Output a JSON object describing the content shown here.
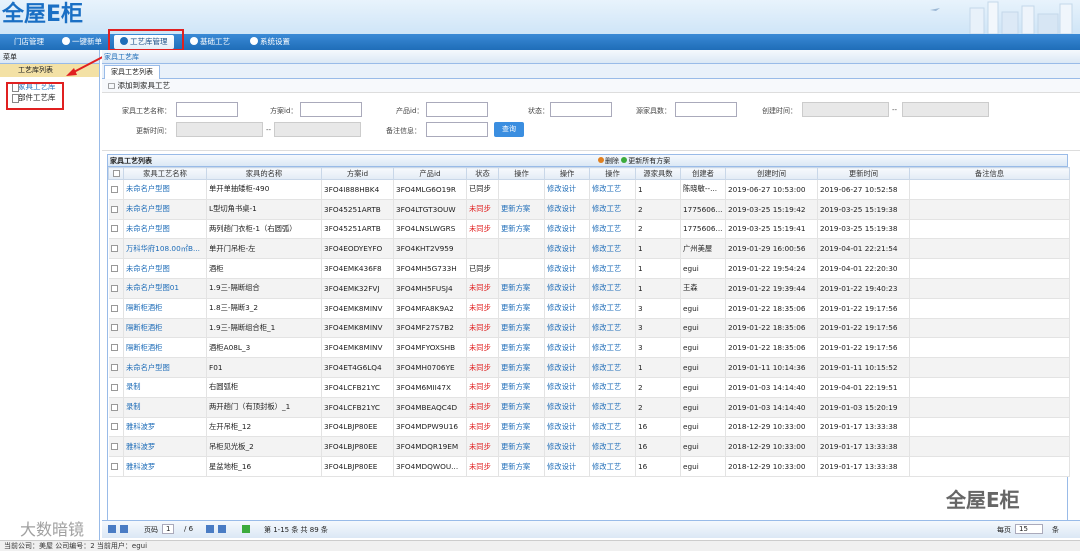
{
  "app": {
    "logo": "全屋E柜"
  },
  "nav": {
    "items": [
      {
        "label": "门店管理"
      },
      {
        "label": "一键新单"
      },
      {
        "label": "工艺库管理"
      },
      {
        "label": "基础工艺"
      },
      {
        "label": "系统设置"
      }
    ]
  },
  "sidebar": {
    "header": "菜单",
    "title": "工艺库列表",
    "items": [
      {
        "label": "家具工艺库"
      },
      {
        "label": "部件工艺库"
      }
    ]
  },
  "main": {
    "breadcrumb": "家具工艺库",
    "tab": "家具工艺列表",
    "add_label": "添加到家具工艺",
    "filters": {
      "craft_name": "家具工艺名称：",
      "square_id": "方案id：",
      "product_id": "产品id：",
      "state": "状态：",
      "source_count": "源家具数：",
      "create_time": "创建时间：",
      "update_time": "更新时间：",
      "remark": "备注信息：",
      "range_sep": "--",
      "query": "查询"
    },
    "grid": {
      "title": "家具工艺列表",
      "delete_label": "删除",
      "update_all_label": "更新所有方案",
      "columns": [
        "家具工艺名称",
        "家具的名称",
        "方案id",
        "产品id",
        "状态",
        "操作",
        "操作",
        "操作",
        "源家具数",
        "创建者",
        "创建时间",
        "更新时间",
        "备注信息"
      ],
      "rows": [
        [
          "未命名户型图",
          "单开单抽矮柜-490",
          "3FO4I888HBK4",
          "3FO4MLG6O19R",
          "已同步",
          "",
          "修改设计",
          "修改工艺",
          "1",
          "陈晓敏--...",
          "2019-06-27 10:53:00",
          "2019-06-27 10:52:58",
          ""
        ],
        [
          "未命名户型图",
          "L型切角书桌-1",
          "3FO45251ARTB",
          "3FO4LTGT3OUW",
          "未同步",
          "更新方案",
          "修改设计",
          "修改工艺",
          "2",
          "1775606...",
          "2019-03-25 15:19:42",
          "2019-03-25 15:19:38",
          ""
        ],
        [
          "未命名户型图",
          "两列趟门衣柜-1（右圆弧）",
          "3FO45251ARTB",
          "3FO4LNSLWGRS",
          "未同步",
          "更新方案",
          "修改设计",
          "修改工艺",
          "2",
          "1775606...",
          "2019-03-25 15:19:41",
          "2019-03-25 15:19:38",
          ""
        ],
        [
          "万科华府108.00㎡B...",
          "单开门吊柜-左",
          "3FO4EODYEYFO",
          "3FO4KHT2V959",
          "",
          "",
          "修改设计",
          "修改工艺",
          "1",
          "广州美屋",
          "2019-01-29 16:00:56",
          "2019-04-01 22:21:54",
          ""
        ],
        [
          "未命名户型图",
          "酒柜",
          "3FO4EMK436F8",
          "3FO4MH5G733H",
          "已同步",
          "",
          "修改设计",
          "修改工艺",
          "1",
          "egui",
          "2019-01-22 19:54:24",
          "2019-04-01 22:20:30",
          ""
        ],
        [
          "未命名户型图01",
          "1.9三-隔断组合",
          "3FO4EMK32FVJ",
          "3FO4MH5FUSJ4",
          "未同步",
          "更新方案",
          "修改设计",
          "修改工艺",
          "1",
          "王森",
          "2019-01-22 19:39:44",
          "2019-01-22 19:40:23",
          ""
        ],
        [
          "隔断柜酒柜",
          "1.8三-隔断3_2",
          "3FO4EMK8MINV",
          "3FO4MFA8K9A2",
          "未同步",
          "更新方案",
          "修改设计",
          "修改工艺",
          "3",
          "egui",
          "2019-01-22 18:35:06",
          "2019-01-22 19:17:56",
          ""
        ],
        [
          "隔断柜酒柜",
          "1.9三-隔断组合柜_1",
          "3FO4EMK8MINV",
          "3FO4MF27S7B2",
          "未同步",
          "更新方案",
          "修改设计",
          "修改工艺",
          "3",
          "egui",
          "2019-01-22 18:35:06",
          "2019-01-22 19:17:56",
          ""
        ],
        [
          "隔断柜酒柜",
          "酒柜A08L_3",
          "3FO4EMK8MINV",
          "3FO4MFYOXSHB",
          "未同步",
          "更新方案",
          "修改设计",
          "修改工艺",
          "3",
          "egui",
          "2019-01-22 18:35:06",
          "2019-01-22 19:17:56",
          ""
        ],
        [
          "未命名户型图",
          "F01",
          "3FO4ET4G6LQ4",
          "3FO4MH0706YE",
          "未同步",
          "更新方案",
          "修改设计",
          "修改工艺",
          "1",
          "egui",
          "2019-01-11 10:14:36",
          "2019-01-11 10:15:52",
          ""
        ],
        [
          "录制",
          "右圆弧柜",
          "3FO4LCFB21YC",
          "3FO4M6MII47X",
          "未同步",
          "更新方案",
          "修改设计",
          "修改工艺",
          "2",
          "egui",
          "2019-01-03 14:14:40",
          "2019-04-01 22:19:51",
          ""
        ],
        [
          "录制",
          "两开趟门（有顶封板）_1",
          "3FO4LCFB21YC",
          "3FO4MBEAQC4D",
          "未同步",
          "更新方案",
          "修改设计",
          "修改工艺",
          "2",
          "egui",
          "2019-01-03 14:14:40",
          "2019-01-03 15:20:19",
          ""
        ],
        [
          "雅科波罗",
          "左开吊柜_12",
          "3FO4LBJP80EE",
          "3FO4MDPW9U16",
          "未同步",
          "更新方案",
          "修改设计",
          "修改工艺",
          "16",
          "egui",
          "2018-12-29 10:33:00",
          "2019-01-17 13:33:38",
          ""
        ],
        [
          "雅科波罗",
          "吊柜见光板_2",
          "3FO4LBJP80EE",
          "3FO4MDQR19EM",
          "未同步",
          "更新方案",
          "修改设计",
          "修改工艺",
          "16",
          "egui",
          "2018-12-29 10:33:00",
          "2019-01-17 13:33:38",
          ""
        ],
        [
          "雅科波罗",
          "星盆地柜_16",
          "3FO4LBJP80EE",
          "3FO4MDQWOU...",
          "未同步",
          "更新方案",
          "修改设计",
          "修改工艺",
          "16",
          "egui",
          "2018-12-29 10:33:00",
          "2019-01-17 13:33:38",
          ""
        ]
      ]
    }
  },
  "pager": {
    "page_label": "页码",
    "page": "1",
    "total_pages": "/ 6",
    "summary": "第 1-15 条  共 89 条",
    "per_page_label": "每页",
    "per_page": "15",
    "unit": "条"
  },
  "status": {
    "text": "当前公司：美屋   公司编号：2   当前用户：egui"
  },
  "watermark": {
    "right": "全屋E柜",
    "left": "大数暗镜"
  },
  "colors": {
    "accent": "#1f6db8",
    "highlight": "#e02020"
  }
}
